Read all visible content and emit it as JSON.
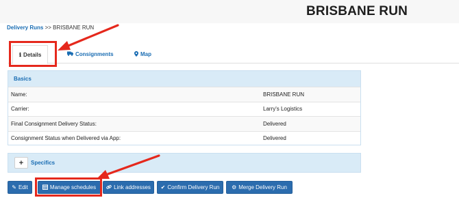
{
  "header": {
    "title": "BRISBANE RUN"
  },
  "breadcrumb": {
    "link": "Delivery Runs",
    "separator": " >> ",
    "current": "BRISBANE RUN"
  },
  "tabs": [
    {
      "label": "Details",
      "icon": "info-icon"
    },
    {
      "label": "Consignments",
      "icon": "truck-icon"
    },
    {
      "label": "Map",
      "icon": "map-marker-icon"
    }
  ],
  "basics": {
    "heading": "Basics",
    "rows": [
      {
        "label": "Name:",
        "value": "BRISBANE RUN"
      },
      {
        "label": "Carrier:",
        "value": "Larry's Logistics"
      },
      {
        "label": "Final Consignment Delivery Status:",
        "value": "Delivered"
      },
      {
        "label": "Consignment Status when Delivered via App:",
        "value": "Delivered"
      }
    ]
  },
  "specifics": {
    "heading": "Specifics",
    "toggle": "+"
  },
  "buttons": {
    "edit": {
      "label": "Edit",
      "icon": "pencil-icon"
    },
    "manage": {
      "label": "Manage schedules",
      "icon": "calendar-icon"
    },
    "link": {
      "label": "Link addresses",
      "icon": "link-icon"
    },
    "confirm": {
      "label": "Confirm Delivery Run",
      "icon": "check-icon"
    },
    "merge": {
      "label": "Merge Delivery Run",
      "icon": "cogs-icon"
    }
  },
  "colors": {
    "accent": "#2b6cae",
    "link": "#1a6db3",
    "panel_heading": "#d9ebf7",
    "annotation": "#e5281c"
  }
}
